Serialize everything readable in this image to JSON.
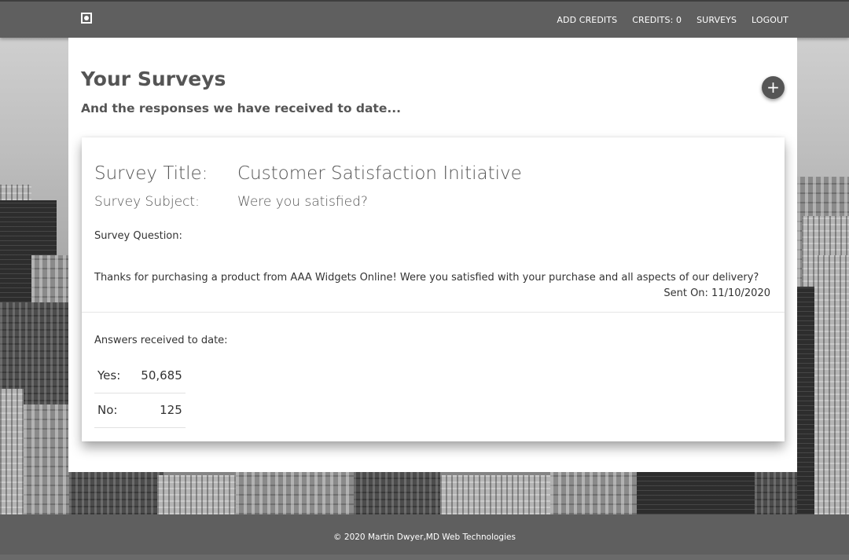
{
  "navbar": {
    "logo_icon": "focus-frame-icon",
    "links": [
      "ADD CREDITS",
      "CREDITS: 0",
      "SURVEYS",
      "LOGOUT"
    ]
  },
  "page": {
    "title": "Your Surveys",
    "subtitle": "And the responses we have received to date...",
    "add_button": "+"
  },
  "survey": {
    "title_label": "Survey Title:",
    "title": "Customer Satisfaction Initiative",
    "subject_label": "Survey Subject:",
    "subject": "Were you satisfied?",
    "question_label": "Survey Question:",
    "question": "Thanks for purchasing a product from AAA Widgets Online! Were you satisfied with your purchase and all aspects of our delivery?",
    "sent_on": "Sent On: 11/10/2020",
    "answers_label": "Answers received to date:",
    "answers": [
      {
        "label": "Yes:",
        "value": "50,685"
      },
      {
        "label": "No:",
        "value": "125"
      }
    ]
  },
  "footer": {
    "text": "© 2020 Martin Dwyer,MD Web Technologies"
  },
  "colors": {
    "navbar": "#5f5f5f",
    "accent": "#555555"
  }
}
